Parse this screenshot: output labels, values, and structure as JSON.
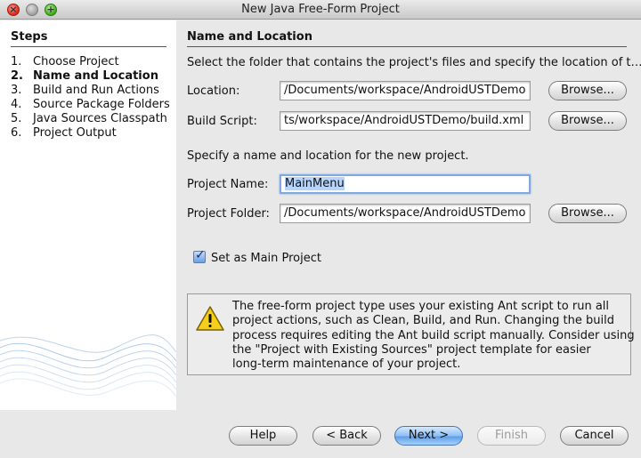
{
  "window": {
    "title": "New Java Free-Form Project"
  },
  "steps": {
    "title": "Steps",
    "items": [
      {
        "num": "1.",
        "label": "Choose Project"
      },
      {
        "num": "2.",
        "label": "Name and Location"
      },
      {
        "num": "3.",
        "label": "Build and Run Actions"
      },
      {
        "num": "4.",
        "label": "Source Package Folders"
      },
      {
        "num": "5.",
        "label": "Java Sources Classpath"
      },
      {
        "num": "6.",
        "label": "Project Output"
      }
    ],
    "current_index": 1
  },
  "main": {
    "title": "Name and Location",
    "intro": "Select the folder that contains the project's files and specify the location of t…",
    "location": {
      "label": "Location:",
      "value": "/Documents/workspace/AndroidUSTDemo",
      "browse": "Browse..."
    },
    "build_script": {
      "label": "Build Script:",
      "value": "ts/workspace/AndroidUSTDemo/build.xml",
      "browse": "Browse..."
    },
    "name_intro": "Specify a name and location for the new project.",
    "project_name": {
      "label": "Project Name:",
      "value": "MainMenu"
    },
    "project_folder": {
      "label": "Project Folder:",
      "value": "/Documents/workspace/AndroidUSTDemo",
      "browse": "Browse..."
    },
    "main_project": {
      "label": "Set as Main Project",
      "checked": true
    },
    "warning": {
      "lines": [
        "The free-form project type uses your existing Ant script to run all",
        "project actions, such as Clean, Build, and Run. Changing the build",
        "process requires editing the Ant build script manually. Consider using",
        "the \"Project with Existing Sources\" project template for easier",
        "long-term maintenance of your  project."
      ]
    }
  },
  "buttons": {
    "help": "Help",
    "back": "< Back",
    "next": "Next >",
    "finish": "Finish",
    "cancel": "Cancel"
  },
  "colors": {
    "accent": "#5d9ee8",
    "selection": "#b5d5ff",
    "focus_ring": "#7fa9e0",
    "warning_yellow": "#f5cf1c"
  }
}
